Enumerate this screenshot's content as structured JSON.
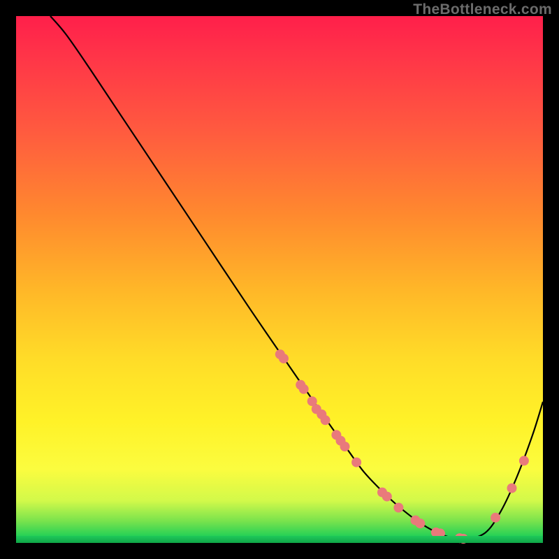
{
  "watermark": "TheBottleneck.com",
  "chart_data": {
    "type": "line",
    "title": "",
    "xlabel": "",
    "ylabel": "",
    "xlim": [
      0,
      100
    ],
    "ylim": [
      0,
      100
    ],
    "grid": false,
    "legend": false,
    "series": [
      {
        "name": "bottleneck-curve",
        "stroke": "#000000",
        "x": [
          6.5,
          9.5,
          14,
          20,
          28,
          36,
          44,
          50.5,
          55,
          59,
          63,
          66,
          69.5,
          73,
          77,
          81,
          85,
          89,
          92,
          95,
          98,
          100
        ],
        "y": [
          100,
          96.5,
          90,
          81,
          69,
          57,
          45,
          35.5,
          29,
          23.2,
          17.6,
          13.5,
          9.8,
          6.6,
          3.6,
          1.5,
          0.7,
          1.9,
          6.0,
          12.4,
          20.4,
          26.8
        ]
      }
    ],
    "scatter": {
      "name": "marker-dots",
      "fill": "#e97a7b",
      "radius": 7,
      "points": [
        {
          "x": 50.1,
          "y": 35.8
        },
        {
          "x": 50.8,
          "y": 35.0
        },
        {
          "x": 54.0,
          "y": 30.0
        },
        {
          "x": 54.6,
          "y": 29.2
        },
        {
          "x": 56.2,
          "y": 26.9
        },
        {
          "x": 57.0,
          "y": 25.4
        },
        {
          "x": 58.0,
          "y": 24.4
        },
        {
          "x": 58.7,
          "y": 23.3
        },
        {
          "x": 60.8,
          "y": 20.5
        },
        {
          "x": 61.6,
          "y": 19.4
        },
        {
          "x": 62.4,
          "y": 18.3
        },
        {
          "x": 64.6,
          "y": 15.3
        },
        {
          "x": 69.5,
          "y": 9.6
        },
        {
          "x": 70.4,
          "y": 8.8
        },
        {
          "x": 72.6,
          "y": 6.7
        },
        {
          "x": 75.8,
          "y": 4.3
        },
        {
          "x": 76.7,
          "y": 3.7
        },
        {
          "x": 79.7,
          "y": 2.0
        },
        {
          "x": 80.5,
          "y": 1.8
        },
        {
          "x": 84.2,
          "y": 0.9
        },
        {
          "x": 84.9,
          "y": 0.8
        },
        {
          "x": 91.0,
          "y": 4.8
        },
        {
          "x": 94.1,
          "y": 10.4
        },
        {
          "x": 96.4,
          "y": 15.6
        }
      ]
    }
  }
}
